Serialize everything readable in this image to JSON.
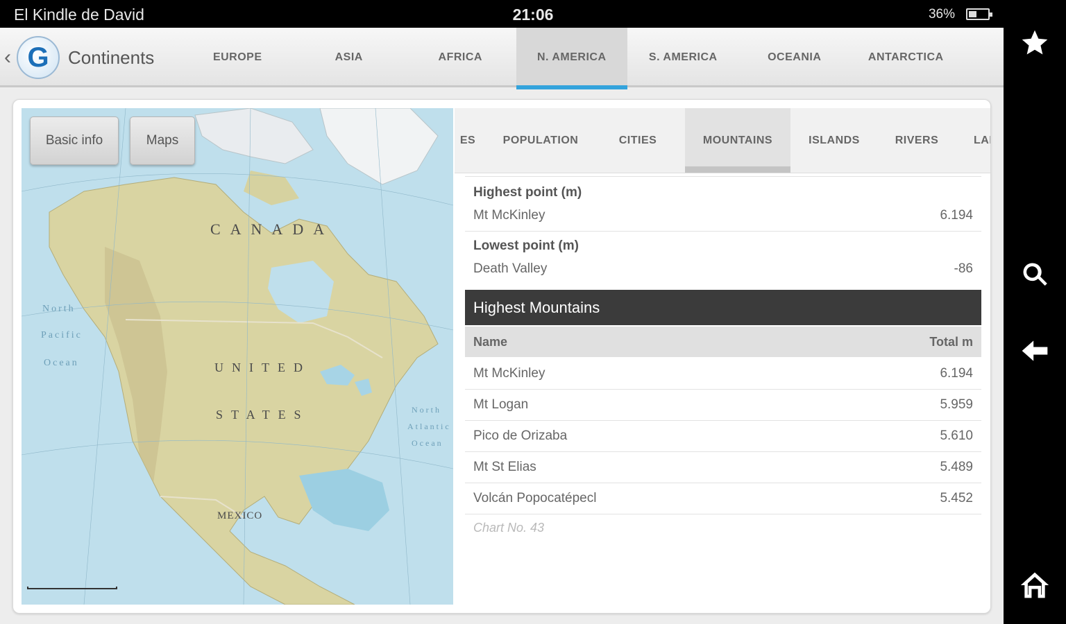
{
  "status_bar": {
    "device_name": "El Kindle de David",
    "time": "21:06",
    "battery": "36%"
  },
  "header": {
    "back_glyph": "‹",
    "logo_letter": "G",
    "title": "Continents",
    "tabs": [
      "EUROPE",
      "ASIA",
      "AFRICA",
      "N. AMERICA",
      "S. AMERICA",
      "OCEANIA",
      "ANTARCTICA"
    ],
    "active_tab": "N. AMERICA"
  },
  "map": {
    "buttons": {
      "basic_info": "Basic info",
      "maps": "Maps"
    },
    "labels": {
      "canada": "CANADA",
      "united": "UNITED",
      "states": "STATES",
      "mexico": "MEXICO"
    },
    "ocean_labels": {
      "north_pacific": [
        "North",
        "Pacific",
        "Ocean"
      ],
      "north_atlantic": [
        "North",
        "Atlantic",
        "Ocean"
      ]
    }
  },
  "subtabs": {
    "items": [
      "ES",
      "POPULATION",
      "CITIES",
      "MOUNTAINS",
      "ISLANDS",
      "RIVERS",
      "LAKE"
    ],
    "active": "MOUNTAINS"
  },
  "summary": {
    "highest_label": "Highest point (m)",
    "highest_name": "Mt McKinley",
    "highest_value": "6.194",
    "lowest_label": "Lowest point (m)",
    "lowest_name": "Death Valley",
    "lowest_value": "-86"
  },
  "mountains": {
    "title": "Highest Mountains",
    "col_name": "Name",
    "col_total": "Total m",
    "rows": [
      {
        "name": "Mt McKinley",
        "value": "6.194"
      },
      {
        "name": "Mt Logan",
        "value": "5.959"
      },
      {
        "name": "Pico de Orizaba",
        "value": "5.610"
      },
      {
        "name": "Mt St Elias",
        "value": "5.489"
      },
      {
        "name": "Volcán Popocatépecl",
        "value": "5.452"
      }
    ],
    "chart_no": "Chart No. 43"
  },
  "nav_icons": [
    "star-icon",
    "search-icon",
    "back-arrow-icon",
    "home-icon"
  ],
  "colors": {
    "accent": "#33a3dc",
    "section_bg": "#3b3b3b",
    "land": "#d8d3a3",
    "water": "#b9dcea"
  }
}
